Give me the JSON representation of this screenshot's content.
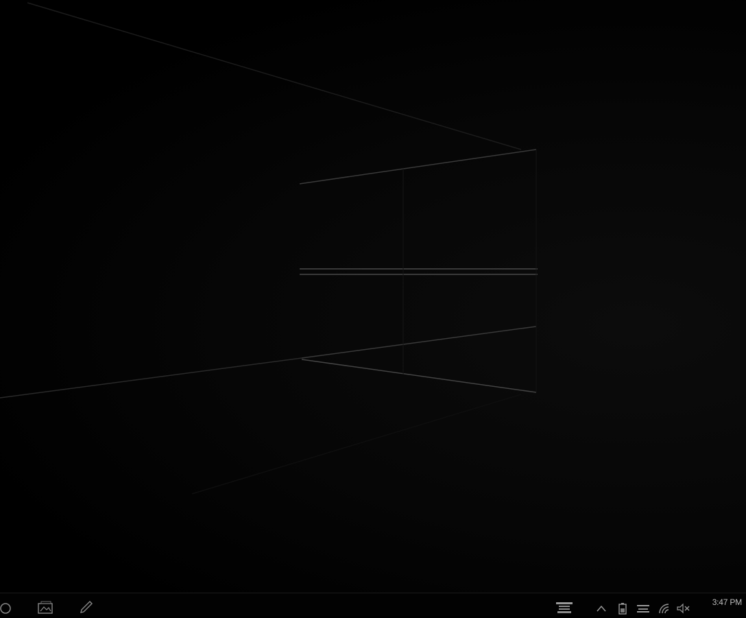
{
  "taskbar": {
    "pinned_icons": [
      "search-icon",
      "photos-icon",
      "pen-icon"
    ],
    "tray_icons": [
      "notes-icon",
      "chevron-up-icon",
      "battery-icon",
      "keyboard-icon",
      "wifi-icon",
      "volume-muted-icon"
    ],
    "clock": {
      "time": "3:47 PM",
      "date": ""
    }
  },
  "colors": {
    "wallpaper_line": "#3a3a3a",
    "wallpaper_bg": "#000000",
    "taskbar_bg": "#020202",
    "icon_color": "#8a8a8a"
  }
}
